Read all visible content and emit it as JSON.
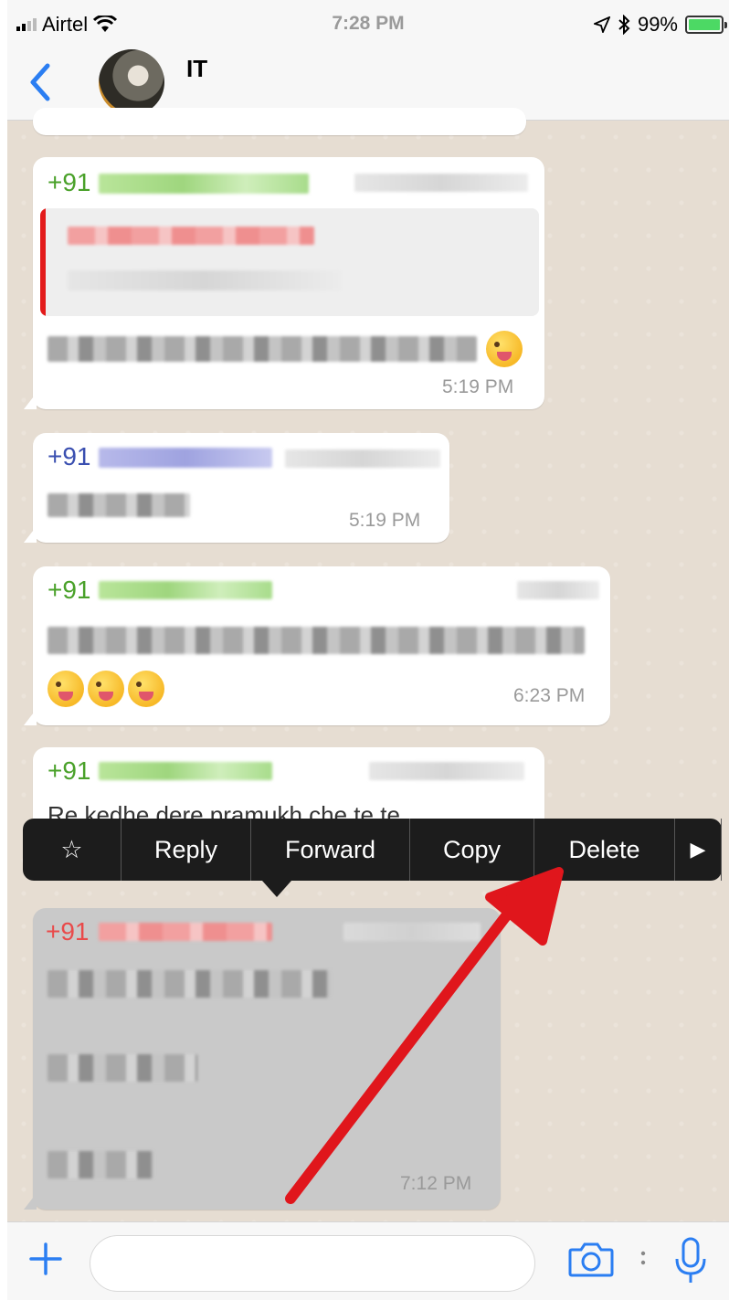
{
  "status_bar": {
    "carrier": "Airtel",
    "time": "7:28 PM",
    "battery": "99%"
  },
  "header": {
    "title": "IT"
  },
  "messages": [
    {
      "sender_prefix": "+91",
      "time": "5:19 PM"
    },
    {
      "sender_prefix": "+91",
      "time": "5:19 PM"
    },
    {
      "sender_prefix": "+91",
      "time": "6:23 PM"
    },
    {
      "sender_prefix": "+91",
      "partial_text": "Re kedhe dere pramukh che te te"
    },
    {
      "sender_prefix": "+91",
      "time": "7:12 PM"
    }
  ],
  "context_menu": {
    "star": "☆",
    "reply": "Reply",
    "forward": "Forward",
    "copy": "Copy",
    "delete": "Delete",
    "more": "▶"
  },
  "colors": {
    "accent": "#2b7ef2",
    "annotation_arrow": "#e0161c"
  }
}
